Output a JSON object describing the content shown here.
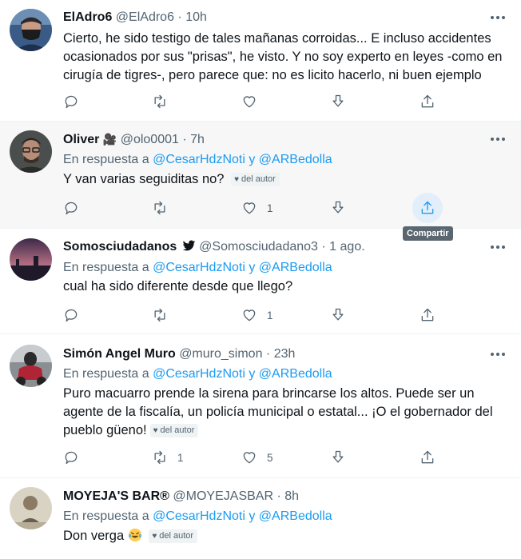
{
  "tweets": [
    {
      "name": "ElAdro6",
      "name_suffix": "",
      "handle": "@ElAdro6",
      "separator": "·",
      "time": "10h",
      "reply_prefix": "",
      "reply_users": "",
      "text_lines": [
        "Cierto, he sido testigo de tales mañanas corroidas... E incluso accidentes",
        "ocasionados por sus \"prisas\", he visto. Y no soy experto en leyes -como en",
        "cirugía de tigres-, pero parece que: no es licito hacerlo, ni buen ejemplo"
      ],
      "author_badge": "",
      "counts": {
        "reply": "",
        "retweet": "",
        "like": ""
      }
    },
    {
      "name": "Oliver",
      "name_suffix": "🎥",
      "handle": "@olo0001",
      "separator": "·",
      "time": "7h",
      "reply_prefix": "En respuesta a",
      "reply_users": "@CesarHdzNoti y @ARBedolla",
      "text_lines": [
        "Y van varias seguiditas no?"
      ],
      "author_badge": "del autor",
      "counts": {
        "reply": "",
        "retweet": "",
        "like": "1"
      }
    },
    {
      "name": "Somosciudadanos",
      "name_suffix": "",
      "handle": "@Somosciudadano3",
      "separator": "·",
      "time": "1 ago.",
      "reply_prefix": "En respuesta a",
      "reply_users": "@CesarHdzNoti y @ARBedolla",
      "text_lines": [
        "cual ha sido diferente desde que llego?"
      ],
      "author_badge": "",
      "counts": {
        "reply": "",
        "retweet": "",
        "like": "1"
      }
    },
    {
      "name": "Simón Angel Muro",
      "name_suffix": "",
      "handle": "@muro_simon",
      "separator": "·",
      "time": "23h",
      "reply_prefix": "En respuesta a",
      "reply_users": "@CesarHdzNoti y @ARBedolla",
      "text_lines": [
        "Puro macuarro prende la sirena para brincarse los altos. Puede ser un",
        "agente de la fiscalía, un policía municipal o estatal... ¡O el gobernador del",
        "pueblo güeno!"
      ],
      "author_badge": "del autor",
      "counts": {
        "reply": "",
        "retweet": "1",
        "like": "5"
      }
    },
    {
      "name": "MOYEJA'S BAR®",
      "name_suffix": "",
      "handle": "@MOYEJASBAR",
      "separator": "·",
      "time": "8h",
      "reply_prefix": "En respuesta a",
      "reply_users": "@CesarHdzNoti y @ARBedolla",
      "text_lines": [
        "Don verga"
      ],
      "author_badge": "del autor",
      "counts": {
        "reply": "",
        "retweet": "",
        "like": ""
      }
    }
  ],
  "tooltip": "Compartir",
  "icons": {
    "reply": "reply-icon",
    "retweet": "retweet-icon",
    "like": "heart-icon",
    "downvote": "downvote-icon",
    "share": "share-icon",
    "more": "more-icon",
    "verified": "twitter-bird-icon",
    "emoji": "laughing-tears-emoji"
  },
  "colors": {
    "link": "#1d9bf0",
    "secondary": "#536471",
    "hover_bg": "#f7f7f7",
    "tooltip_bg": "#5b6770"
  }
}
